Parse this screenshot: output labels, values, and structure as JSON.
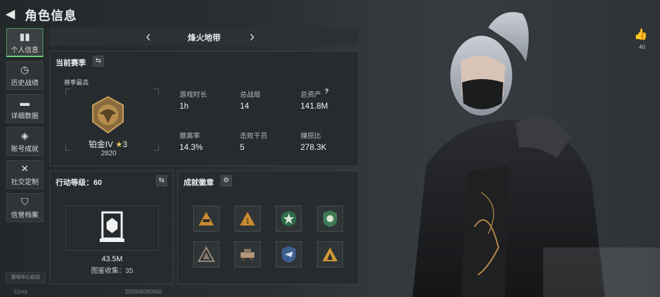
{
  "header": {
    "title": "角色信息"
  },
  "sidebar": {
    "items": [
      {
        "label": "个人信息",
        "icon": "bar-chart-icon"
      },
      {
        "label": "历史战绩",
        "icon": "history-icon"
      },
      {
        "label": "详细数据",
        "icon": "folder-icon"
      },
      {
        "label": "账号成就",
        "icon": "trophy-icon"
      },
      {
        "label": "社交定制",
        "icon": "tools-icon"
      },
      {
        "label": "信誉档案",
        "icon": "shield-icon"
      }
    ],
    "footer": "游戏中心启动"
  },
  "status": {
    "ping": "51ms",
    "id": "202606080958"
  },
  "map": {
    "name": "烽火地带"
  },
  "season": {
    "title": "当前赛季",
    "best_label": "赛季最高",
    "rank_name": "铂金IV",
    "rank_stars": "3",
    "rank_score": "2820",
    "stats": [
      {
        "label": "游戏时长",
        "value": "1h"
      },
      {
        "label": "总战局",
        "value": "14"
      },
      {
        "label": "总资产",
        "value": "141.8M"
      },
      {
        "label": "撤离率",
        "value": "14.3%"
      },
      {
        "label": "击败干员",
        "value": "5"
      },
      {
        "label": "赚损比",
        "value": "278.3K"
      }
    ]
  },
  "action": {
    "title": "行动等级：60",
    "value": "43.5M",
    "collection": "图鉴收集：35"
  },
  "achievements": {
    "title": "成就徽章"
  },
  "like": {
    "count": "40"
  }
}
